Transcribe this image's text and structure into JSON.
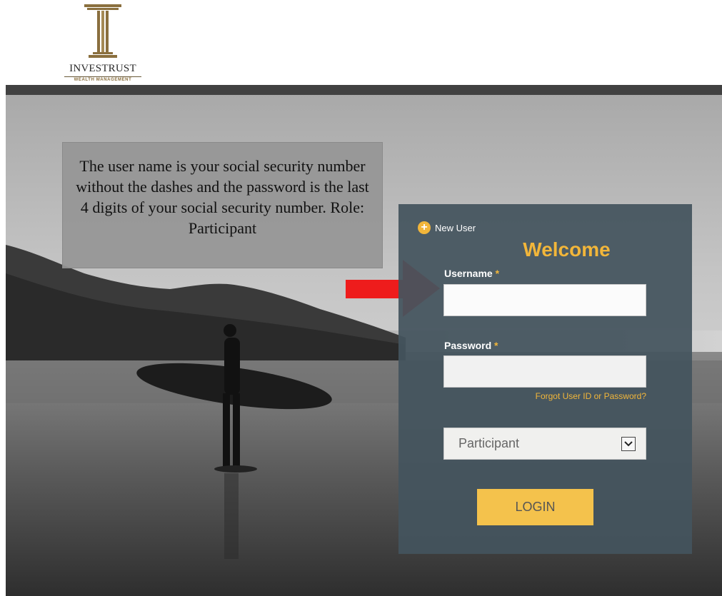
{
  "brand": {
    "name": "INVESTRUST",
    "tagline": "WEALTH MANAGEMENT",
    "gold": "#8a6f3e"
  },
  "instructions": {
    "text": "The user name is your social security number without the dashes and the password is the last 4 digits of your social security number. Role: Participant"
  },
  "login": {
    "new_user_label": "New User",
    "title": "Welcome",
    "username_label": "Username",
    "password_label": "Password",
    "required_mark": "*",
    "username_value": "",
    "password_value": "",
    "forgot_link": "Forgot User ID or Password?",
    "role_selected": "Participant",
    "login_button": "LOGIN"
  },
  "colors": {
    "accent": "#f2b63a",
    "panel": "#44545e",
    "header_bar": "#414141",
    "arrow": "#ee1c1c"
  },
  "icons": {
    "new_user": "plus-circle-icon",
    "role_dropdown": "chevron-down-icon",
    "pointer": "red-arrow-icon",
    "logo": "column-icon"
  }
}
